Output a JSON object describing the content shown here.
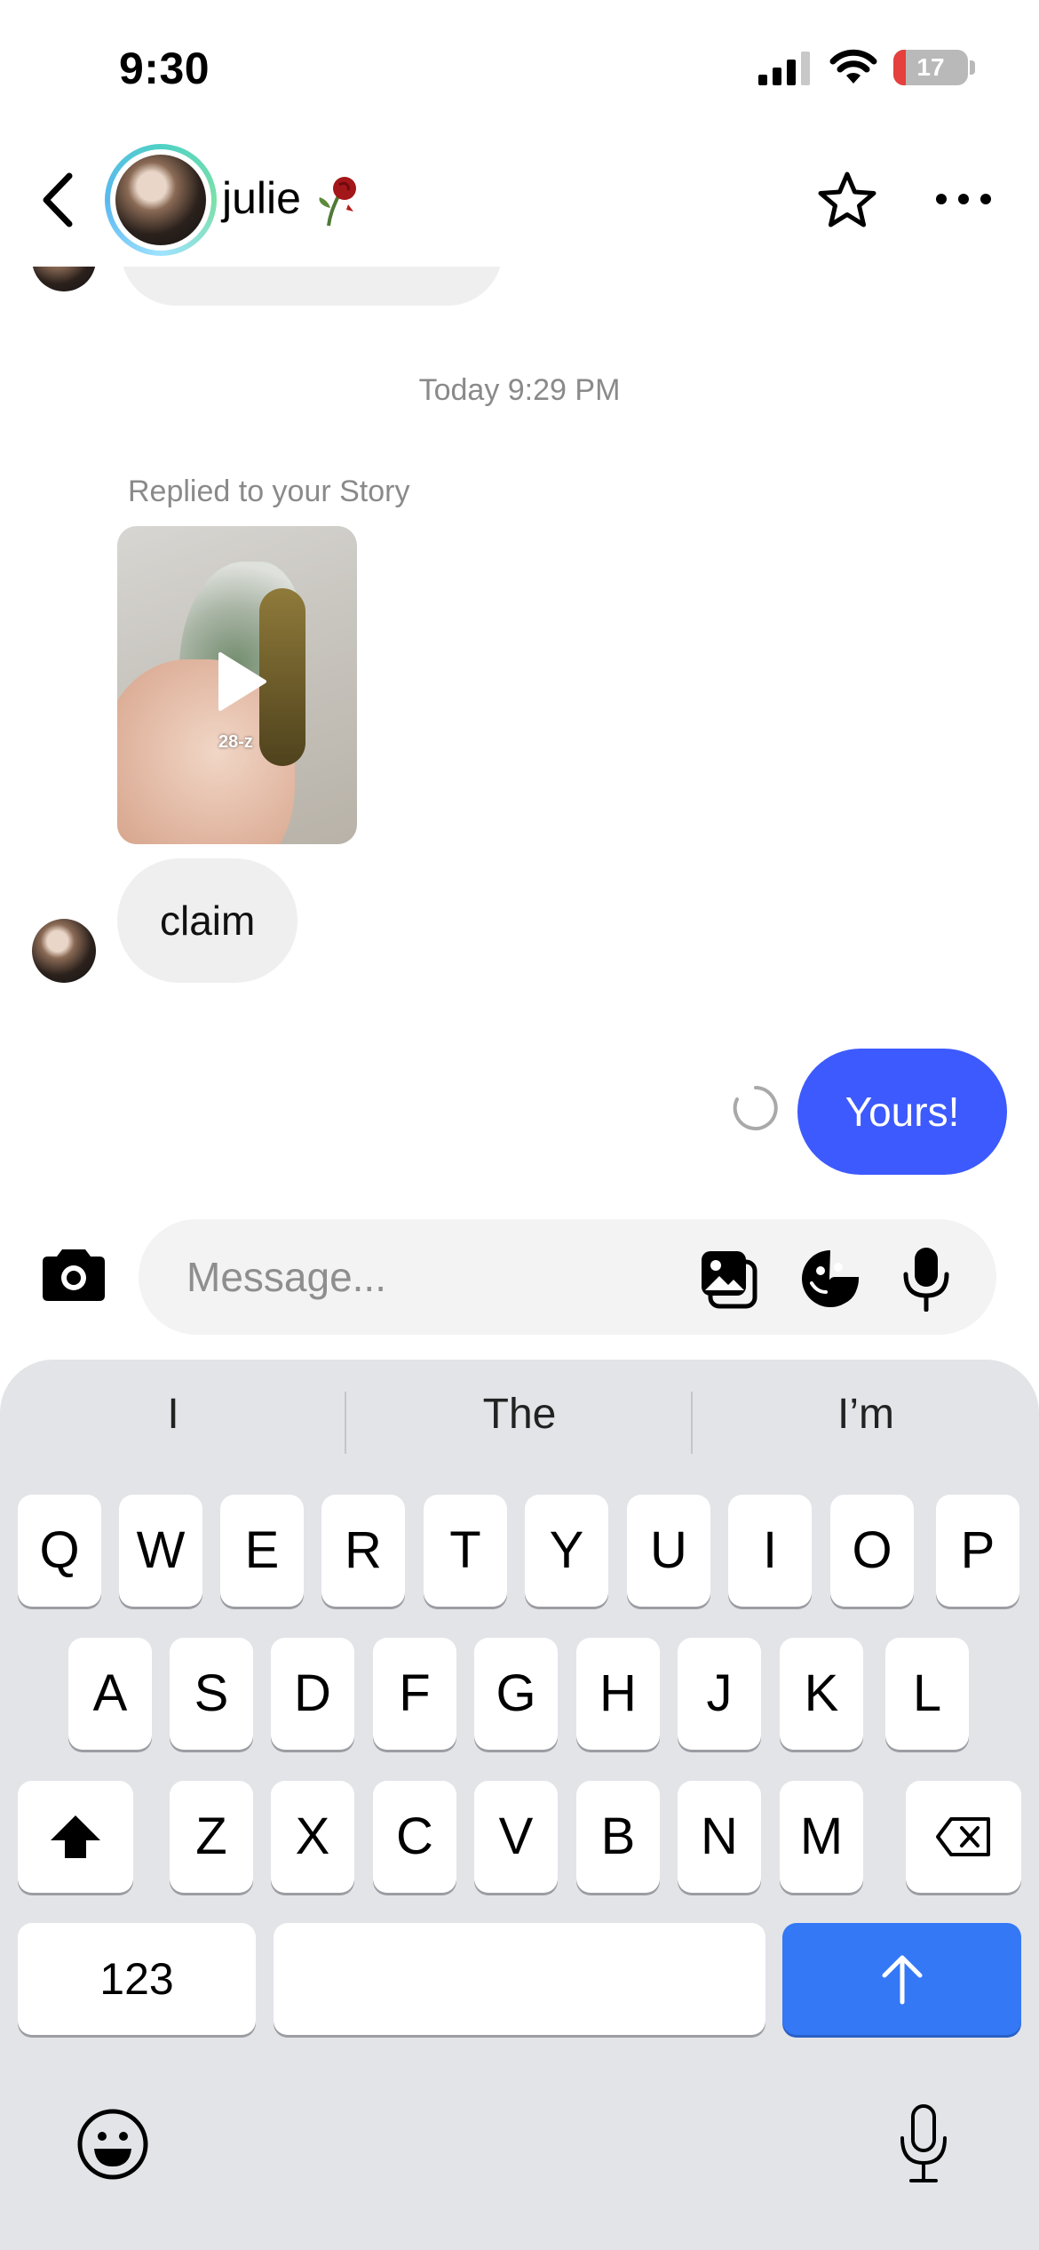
{
  "status_bar": {
    "time": "9:30",
    "battery_text": "17",
    "battery_level": 0.17
  },
  "header": {
    "contact_name": "julie",
    "name_emoji_icon": "wilted-rose-icon",
    "back_icon": "chevron-left-icon",
    "star_icon": "star-outline-icon",
    "more_icon": "ellipsis-icon"
  },
  "chat": {
    "timestamp": "Today 9:29 PM",
    "story_reply_label": "Replied to your Story",
    "story_overlay_text": "28-z",
    "incoming_message": "claim",
    "outgoing_message": "Yours!",
    "outgoing_color": "#3d5afe"
  },
  "composer": {
    "placeholder": "Message...",
    "camera_icon": "camera-icon",
    "gallery_icon": "photo-gallery-icon",
    "sticker_icon": "sticker-icon",
    "voice_icon": "microphone-icon"
  },
  "keyboard": {
    "suggestions": [
      "I",
      "The",
      "I’m"
    ],
    "row1": [
      "Q",
      "W",
      "E",
      "R",
      "T",
      "Y",
      "U",
      "I",
      "O",
      "P"
    ],
    "row2": [
      "A",
      "S",
      "D",
      "F",
      "G",
      "H",
      "J",
      "K",
      "L"
    ],
    "row3": [
      "Z",
      "X",
      "C",
      "V",
      "B",
      "N",
      "M"
    ],
    "numbers_key": "123",
    "send_color": "#3478f6"
  }
}
